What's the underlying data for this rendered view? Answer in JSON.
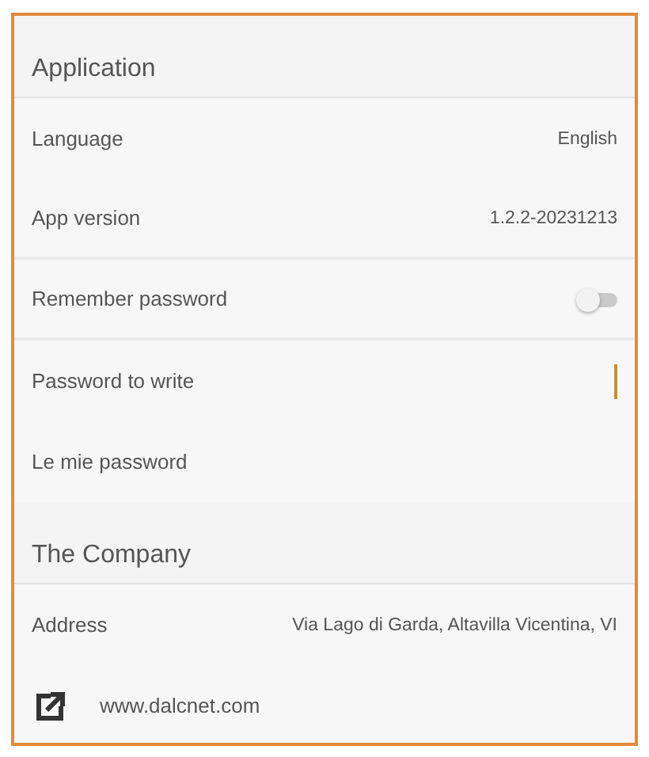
{
  "sections": [
    {
      "title": "Application",
      "rows": [
        {
          "kind": "value",
          "label": "Language",
          "value": "English",
          "divider": false
        },
        {
          "kind": "value",
          "label": "App version",
          "value": "1.2.2-20231213",
          "divider": true
        },
        {
          "kind": "toggle",
          "label": "Remember password",
          "on": false,
          "divider": true
        },
        {
          "kind": "field",
          "label": "Password to write",
          "divider": false
        },
        {
          "kind": "plain",
          "label": "Le mie password",
          "divider": false
        }
      ]
    },
    {
      "title": "The Company",
      "rows": [
        {
          "kind": "value",
          "label": "Address",
          "value": "Via Lago di Garda, Altavilla Vicentina, VI",
          "divider": false
        },
        {
          "kind": "link",
          "label": "www.dalcnet.com",
          "divider": false
        }
      ]
    }
  ]
}
